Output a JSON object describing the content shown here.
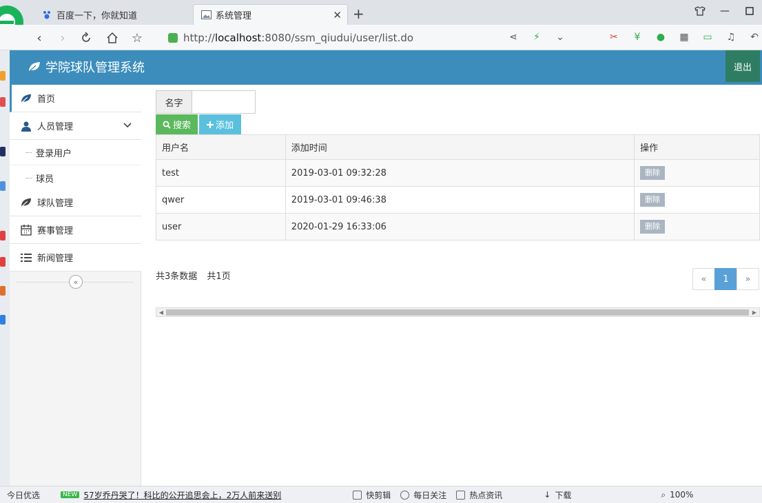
{
  "browser": {
    "tabs": [
      {
        "title": "百度一下，你就知道",
        "active": false
      },
      {
        "title": "系统管理",
        "active": true
      }
    ],
    "url_prefix": "http://",
    "url_host": "localhost",
    "url_rest": ":8080/ssm_qiudui/user/list.do",
    "zoom": "100%"
  },
  "header": {
    "title": "学院球队管理系统",
    "logout_label": "退出"
  },
  "sidebar": {
    "items": [
      {
        "label": "首页",
        "icon": "leaf-icon"
      },
      {
        "label": "人员管理",
        "icon": "user-icon",
        "expanded": true,
        "children": [
          {
            "label": "登录用户"
          },
          {
            "label": "球员"
          }
        ]
      },
      {
        "label": "球队管理",
        "icon": "leaf-icon"
      },
      {
        "label": "赛事管理",
        "icon": "calendar-icon"
      },
      {
        "label": "新闻管理",
        "icon": "list-icon"
      }
    ],
    "collapse_label": "«"
  },
  "search": {
    "label": "名字",
    "value": "",
    "search_label": "搜索",
    "add_label": "添加"
  },
  "table": {
    "columns": [
      "用户名",
      "添加时间",
      "操作"
    ],
    "rows": [
      {
        "username": "test",
        "time": "2019-03-01 09:32:28",
        "action": "删除"
      },
      {
        "username": "qwer",
        "time": "2019-03-01 09:46:38",
        "action": "删除"
      },
      {
        "username": "user",
        "time": "2020-01-29 16:33:06",
        "action": "删除"
      }
    ]
  },
  "pagination": {
    "total_text": "共3条数据",
    "pages_text": "共1页",
    "prev": "«",
    "current": "1",
    "next": "»"
  },
  "statusbar": {
    "left": "今日优选",
    "new_badge": "NEW",
    "news": "57岁乔丹哭了！科比的公开追思会上，2万人前来送别",
    "tools": [
      "快剪辑",
      "每日关注",
      "热点资讯",
      "下载"
    ]
  },
  "colors": {
    "header": "#3c8dbc",
    "logout": "#2e7d62",
    "search_btn": "#5cb85c",
    "add_btn": "#5bc0de",
    "page_active": "#5aa0d8"
  }
}
